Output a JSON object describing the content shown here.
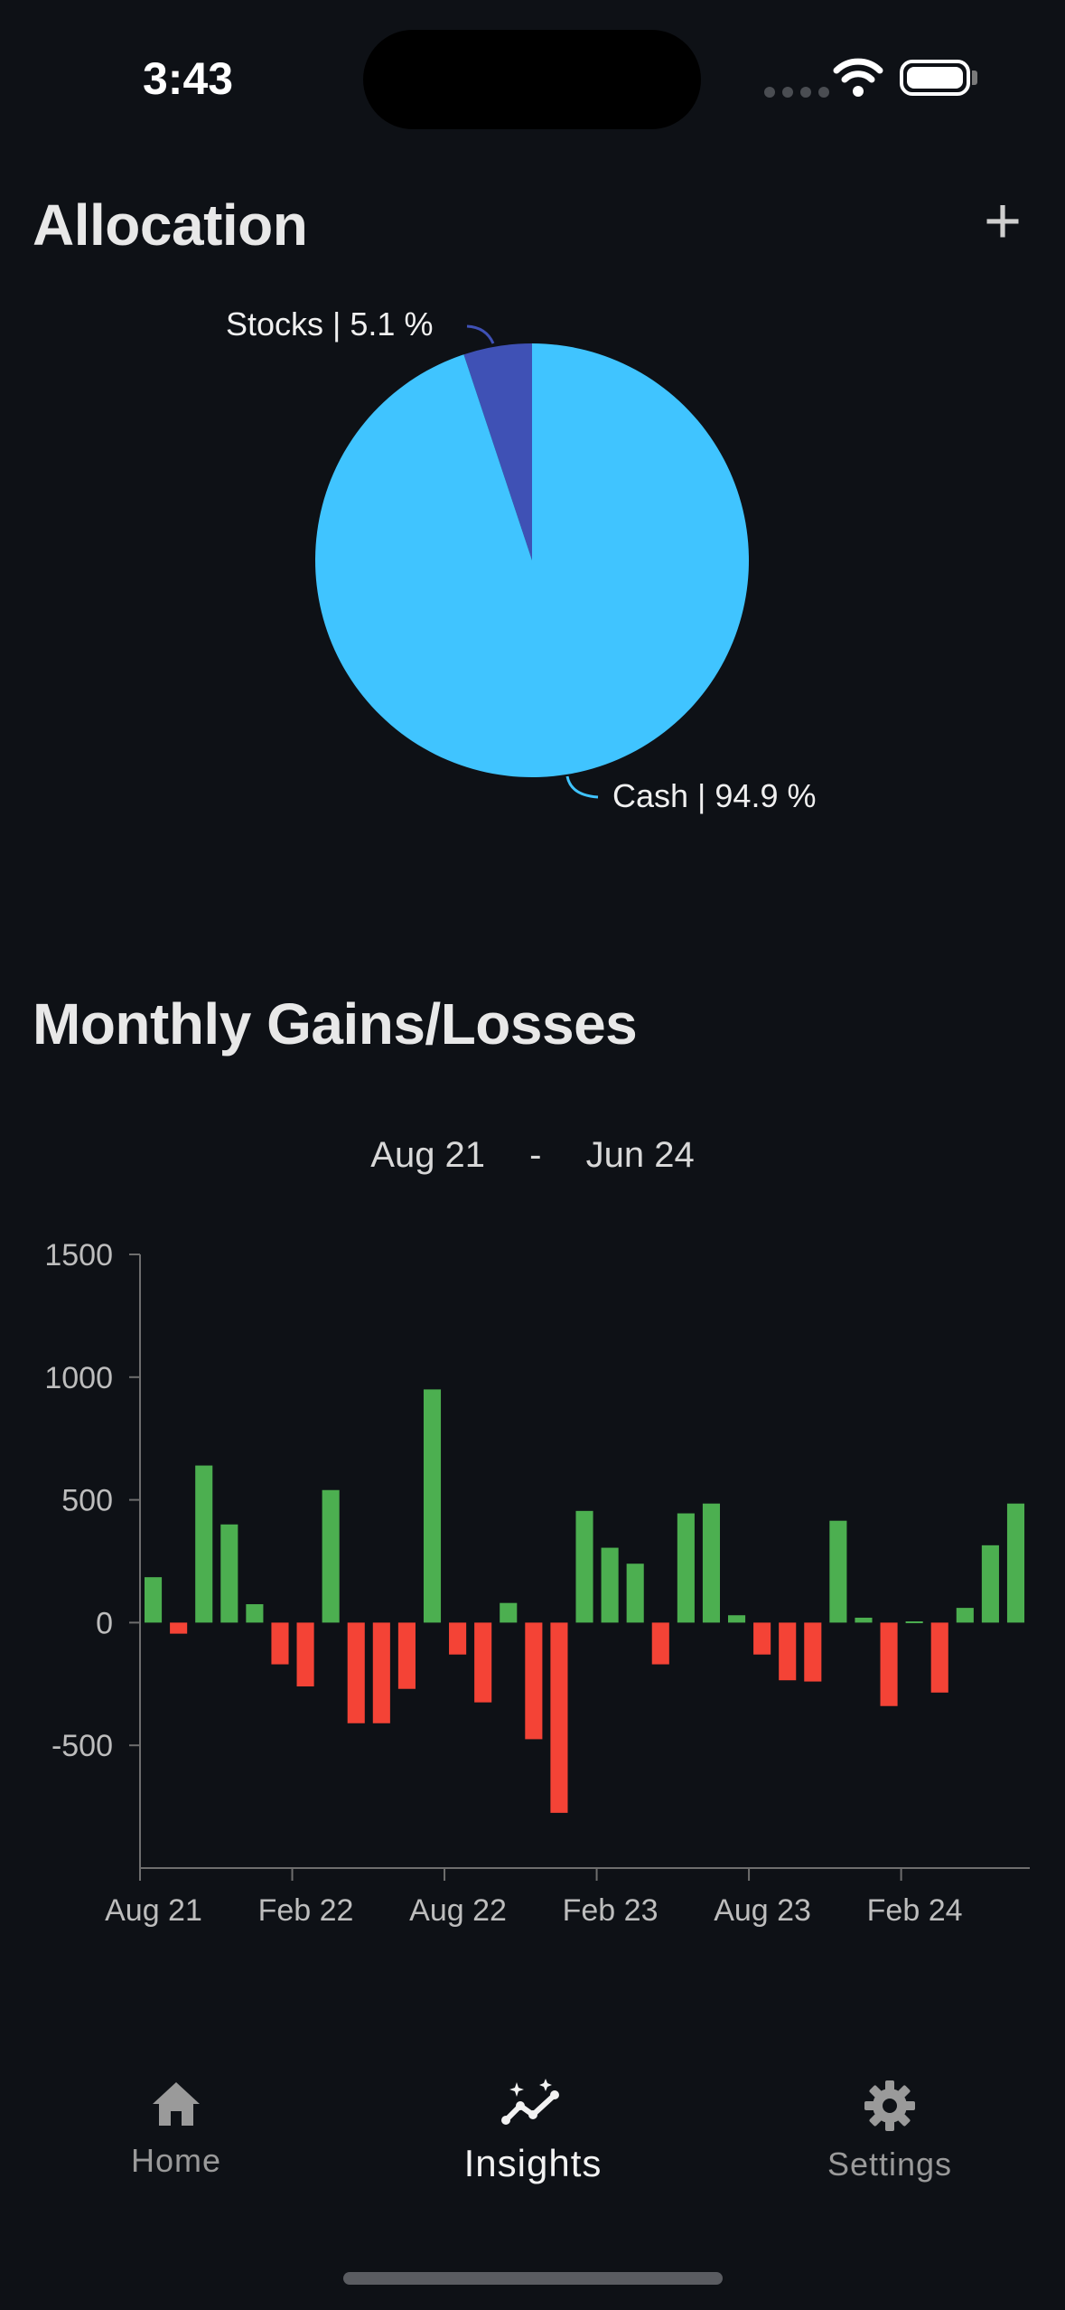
{
  "status_bar": {
    "time": "3:43"
  },
  "allocation": {
    "title": "Allocation",
    "add_label": "+",
    "slices": [
      {
        "name": "Stocks",
        "percent": 5.1,
        "label": "Stocks | 5.1 %",
        "color": "#3f51b5"
      },
      {
        "name": "Cash",
        "percent": 94.9,
        "label": "Cash | 94.9 %",
        "color": "#40c4ff"
      }
    ]
  },
  "gains": {
    "title": "Monthly Gains/Losses",
    "range_start": "Aug 21",
    "range_sep": "-",
    "range_end": "Jun 24"
  },
  "chart_data": [
    {
      "type": "pie",
      "labels": [
        "Stocks",
        "Cash"
      ],
      "values": [
        5.1,
        94.9
      ],
      "colors": [
        "#3f51b5",
        "#40c4ff"
      ]
    },
    {
      "type": "bar",
      "categories": [
        "Aug 21",
        "Sep 21",
        "Oct 21",
        "Nov 21",
        "Dec 21",
        "Jan 22",
        "Feb 22",
        "Mar 22",
        "Apr 22",
        "May 22",
        "Jun 22",
        "Jul 22",
        "Aug 22",
        "Sep 22",
        "Oct 22",
        "Nov 22",
        "Dec 22",
        "Jan 23",
        "Feb 23",
        "Mar 23",
        "Apr 23",
        "May 23",
        "Jun 23",
        "Jul 23",
        "Aug 23",
        "Sep 23",
        "Oct 23",
        "Nov 23",
        "Dec 23",
        "Jan 24",
        "Feb 24",
        "Mar 24",
        "Apr 24",
        "May 24",
        "Jun 24"
      ],
      "values": [
        185,
        -45,
        640,
        400,
        75,
        -170,
        -260,
        540,
        -410,
        -410,
        -270,
        950,
        -130,
        -325,
        80,
        -475,
        -775,
        455,
        305,
        240,
        -170,
        445,
        485,
        30,
        -130,
        -235,
        -240,
        415,
        20,
        -340,
        5,
        -285,
        60,
        315,
        485
      ],
      "positive_color": "#4caf50",
      "negative_color": "#f44336",
      "yticks": [
        1500,
        1000,
        500,
        0,
        -500
      ],
      "ytick_labels": [
        "1500",
        "1000",
        "500",
        "0",
        "-500"
      ],
      "ylim": [
        -1000,
        1500
      ],
      "xtick_labels": [
        "Aug 21",
        "Feb 22",
        "Aug 22",
        "Feb 23",
        "Aug 23",
        "Feb 24"
      ],
      "xtick_months": [
        0,
        6,
        12,
        18,
        24,
        30
      ],
      "grid": false
    }
  ],
  "tabs": [
    {
      "label": "Home",
      "icon": "home-icon",
      "active": false
    },
    {
      "label": "Insights",
      "icon": "insights-icon",
      "active": true
    },
    {
      "label": "Settings",
      "icon": "gear-icon",
      "active": false
    }
  ]
}
